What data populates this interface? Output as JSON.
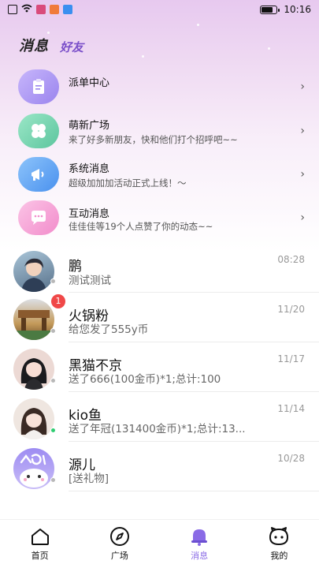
{
  "status_bar": {
    "time": "10:16"
  },
  "header": {
    "tab_active": "消息",
    "tab_inactive": "好友"
  },
  "system_items": [
    {
      "title": "派单中心",
      "subtitle": "",
      "icon": "clipboard-icon",
      "color": "#a999f0"
    },
    {
      "title": "萌新广场",
      "subtitle": "来了好多新朋友，快和他们打个招呼吧~~",
      "icon": "clover-icon",
      "color": "#71d2b0"
    },
    {
      "title": "系统消息",
      "subtitle": "超级加加加活动正式上线！～",
      "icon": "megaphone-icon",
      "color": "#5aa4f2"
    },
    {
      "title": "互动消息",
      "subtitle": "佳佳佳等19个人点赞了你的动态~~",
      "icon": "chat-icon",
      "color": "#f59ad2"
    }
  ],
  "chats": [
    {
      "name": "鹏",
      "message": "测试测试",
      "time": "08:28",
      "badge": "",
      "online": false
    },
    {
      "name": "火锅粉",
      "message": "给您发了555y币",
      "time": "11/20",
      "badge": "1",
      "online": false
    },
    {
      "name": "黑猫不京",
      "message": "送了666(100金币)*1;总计:100",
      "time": "11/17",
      "badge": "",
      "online": false
    },
    {
      "name": "kio鱼",
      "message": "送了年冠(131400金币)*1;总计:13...",
      "time": "11/14",
      "badge": "",
      "online": true
    },
    {
      "name": "源儿",
      "message": "[送礼物]",
      "time": "10/28",
      "badge": "",
      "online": false
    }
  ],
  "nav": [
    {
      "label": "首页",
      "icon": "home-icon"
    },
    {
      "label": "广场",
      "icon": "compass-icon"
    },
    {
      "label": "消息",
      "icon": "bell-icon",
      "active": true
    },
    {
      "label": "我的",
      "icon": "profile-icon"
    }
  ],
  "colors": {
    "accent": "#8a6be6",
    "badge": "#f04848",
    "online": "#2ecc71",
    "offline": "#b8b8b8"
  }
}
